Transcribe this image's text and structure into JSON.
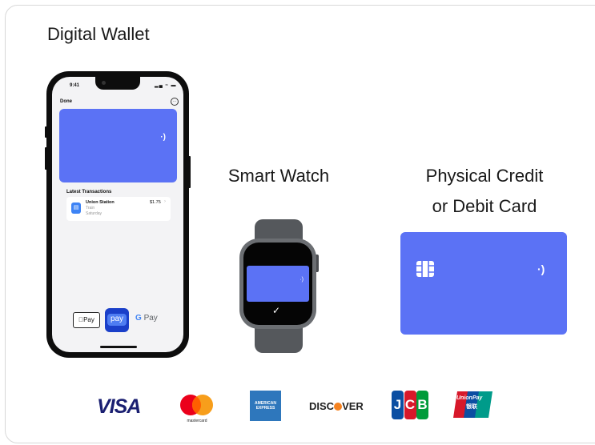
{
  "title": "Digital Wallet",
  "labels": {
    "smart_watch": "Smart Watch",
    "physical_line1": "Physical Credit",
    "physical_line2": "or Debit Card"
  },
  "phone": {
    "status_time": "9:41",
    "status_icons": "▂▄ ≈ ▬",
    "done": "Done",
    "more_icon": "···",
    "nfc_icon": "·)",
    "latest_transactions": "Latest Transactions",
    "transaction": {
      "name": "Union Station",
      "sub1": "Train",
      "sub2": "Saturday",
      "amount": "$1.75",
      "chevron": "›"
    },
    "apple_pay": "Pay",
    "samsung_pay": "pay",
    "google_pay_g": "G",
    "google_pay": "Pay"
  },
  "watch": {
    "nfc_icon": "·)",
    "check": "✓"
  },
  "card": {
    "nfc_icon": "·)"
  },
  "logos": {
    "visa": "VISA",
    "mastercard": "mastercard",
    "amex": "AMERICAN EXPRESS",
    "discover_pre": "DISC",
    "discover_post": "VER",
    "jcb": [
      "J",
      "C",
      "B"
    ],
    "unionpay": "UnionPay",
    "unionpay_cn": "银联"
  },
  "colors": {
    "card_blue": "#5b72f5",
    "visa_blue": "#1a1f71",
    "mc_red": "#eb001b",
    "mc_yellow": "#f79e1b",
    "amex_blue": "#2e77bc",
    "discover_orange": "#f58220",
    "jcb_blue": "#0b4ea2",
    "jcb_red": "#d7182a",
    "jcb_green": "#009b3a"
  }
}
